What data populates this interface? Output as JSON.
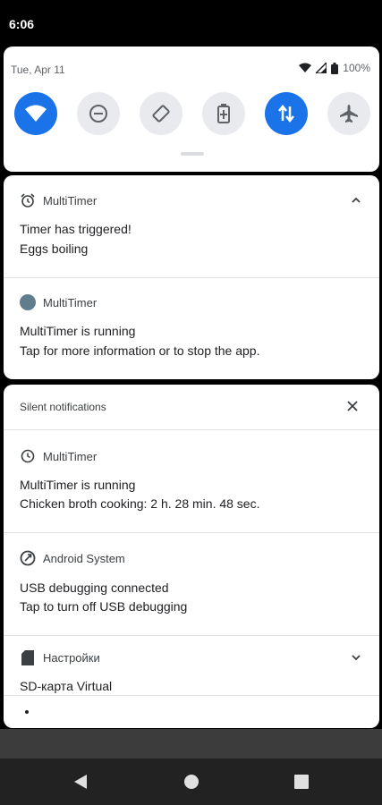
{
  "status_bar": {
    "time": "6:06"
  },
  "quick_settings": {
    "date": "Tue, Apr 11",
    "battery": "100%",
    "tiles": [
      {
        "name": "wifi",
        "on": true
      },
      {
        "name": "do-not-disturb",
        "on": false
      },
      {
        "name": "auto-rotate",
        "on": false
      },
      {
        "name": "battery-saver",
        "on": false
      },
      {
        "name": "mobile-data",
        "on": true
      },
      {
        "name": "airplane-mode",
        "on": false
      }
    ]
  },
  "notifications": {
    "timer": {
      "app": "MultiTimer",
      "title": "Timer has triggered!",
      "text": "Eggs boiling"
    },
    "running": {
      "app": "MultiTimer",
      "title": "MultiTimer is running",
      "text": "Tap for more information or to stop the app."
    }
  },
  "silent": {
    "header": "Silent notifications",
    "items": [
      {
        "app": "MultiTimer",
        "title": "MultiTimer is running",
        "text": "Chicken broth cooking: 2 h. 28 min. 48 sec."
      },
      {
        "app": "Android System",
        "title": "USB debugging connected",
        "text": "Tap to turn off USB debugging"
      },
      {
        "app": "Настройки",
        "title": "SD-карта Virtual"
      }
    ]
  },
  "colors": {
    "accent": "#1a73e8",
    "tile_off": "#e8eaed"
  }
}
